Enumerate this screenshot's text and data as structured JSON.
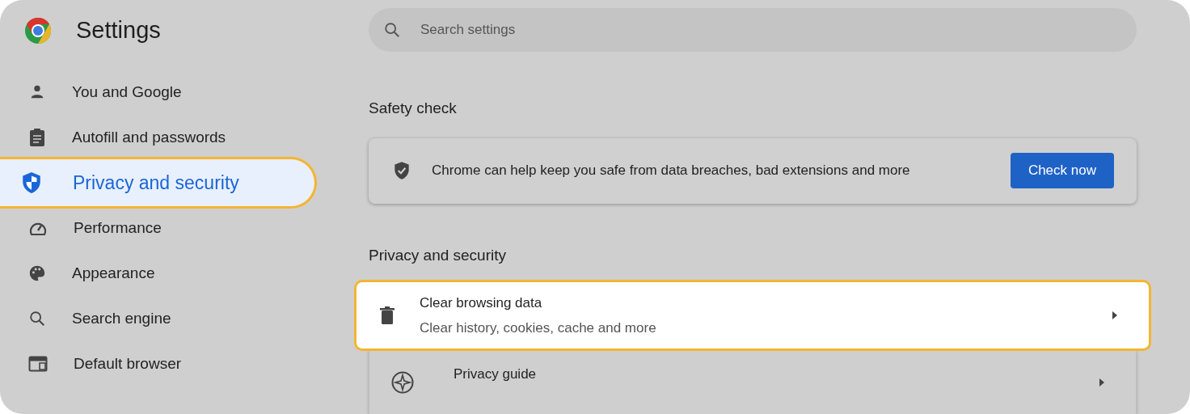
{
  "app": {
    "title": "Settings"
  },
  "sidebar": {
    "items": [
      {
        "label": "You and Google",
        "selected": false
      },
      {
        "label": "Autofill and passwords",
        "selected": false
      },
      {
        "label": "Privacy and security",
        "selected": true
      },
      {
        "label": "Performance",
        "selected": false
      },
      {
        "label": "Appearance",
        "selected": false
      },
      {
        "label": "Search engine",
        "selected": false
      },
      {
        "label": "Default browser",
        "selected": false
      }
    ]
  },
  "search": {
    "placeholder": "Search settings"
  },
  "safety_check": {
    "heading": "Safety check",
    "text": "Chrome can help keep you safe from data breaches, bad extensions and more",
    "button": "Check now"
  },
  "privacy": {
    "heading": "Privacy and security",
    "rows": [
      {
        "title": "Clear browsing data",
        "subtitle": "Clear history, cookies, cache and more",
        "highlighted": true
      },
      {
        "title": "Privacy guide",
        "highlighted": false
      }
    ]
  }
}
